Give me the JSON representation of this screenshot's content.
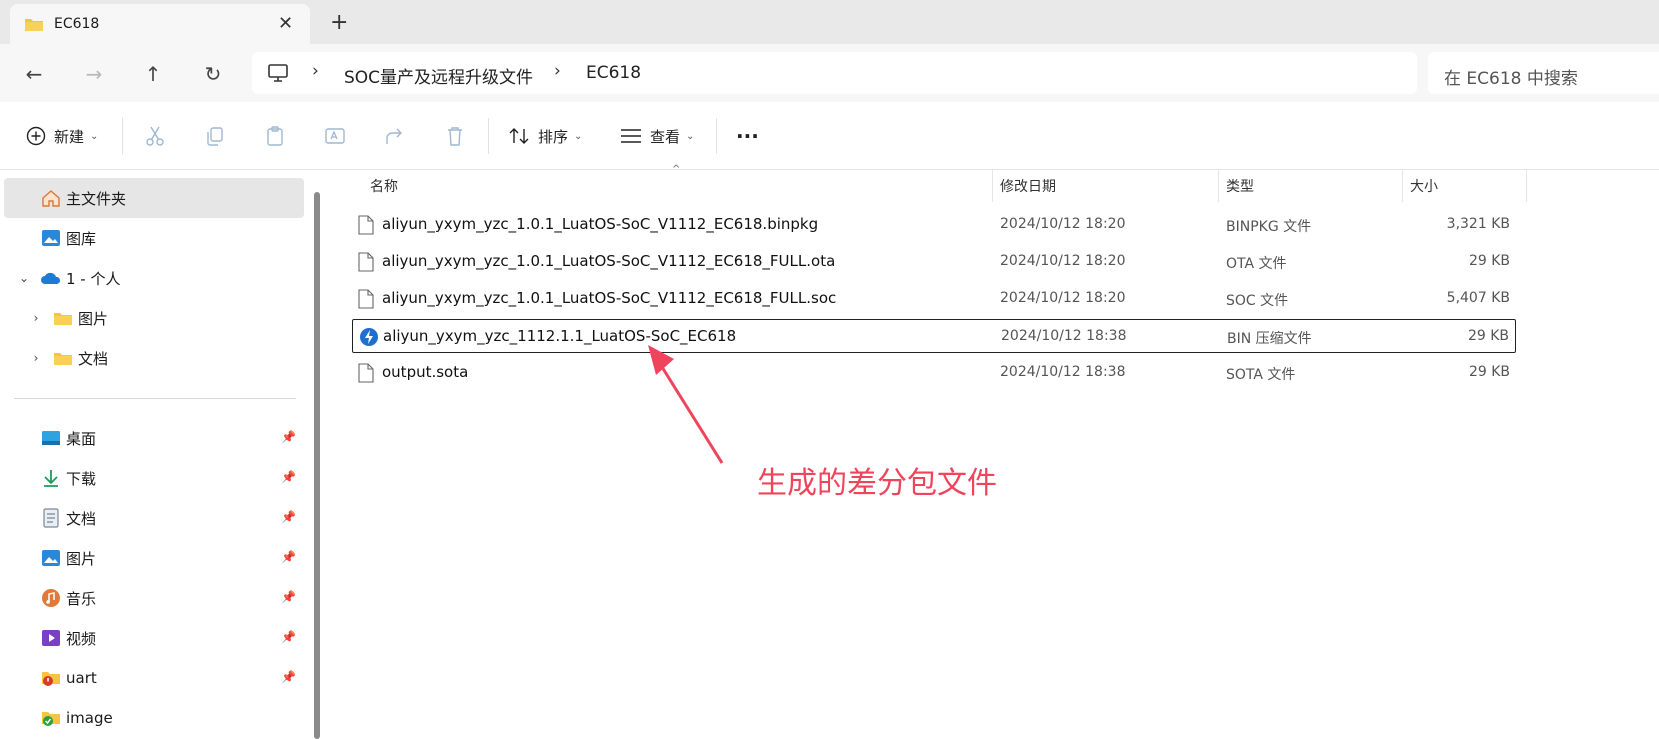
{
  "window": {
    "tab_title": "EC618",
    "close_glyph": "✕",
    "newtab_glyph": "+"
  },
  "nav": {
    "back_glyph": "←",
    "forward_glyph": "→",
    "up_glyph": "↑",
    "refresh_glyph": "↻"
  },
  "breadcrumb": {
    "separator": "›",
    "items": [
      "SOC量产及远程升级文件",
      "EC618"
    ]
  },
  "search": {
    "placeholder": "在 EC618 中搜索"
  },
  "toolbar": {
    "new_label": "新建",
    "sort_label": "排序",
    "view_label": "查看",
    "more_glyph": "···",
    "chevron": "⌄"
  },
  "sidebar": {
    "home": "主文件夹",
    "gallery": "图库",
    "onedrive": "1 - 个人",
    "onedrive_children": [
      "图片",
      "文档"
    ],
    "quick_access": [
      {
        "label": "桌面",
        "icon": "desktop-icon"
      },
      {
        "label": "下载",
        "icon": "download-icon"
      },
      {
        "label": "文档",
        "icon": "documents-icon"
      },
      {
        "label": "图片",
        "icon": "pictures-icon"
      },
      {
        "label": "音乐",
        "icon": "music-icon"
      },
      {
        "label": "视频",
        "icon": "video-icon"
      },
      {
        "label": "uart",
        "icon": "folder-icon"
      },
      {
        "label": "image",
        "icon": "folder-icon"
      }
    ],
    "pin_glyph": "📌",
    "expand_glyph": "›",
    "expanded_glyph": "⌄"
  },
  "columns": {
    "name": "名称",
    "date": "修改日期",
    "type": "类型",
    "size": "大小"
  },
  "files": [
    {
      "name": "aliyun_yxym_yzc_1.0.1_LuatOS-SoC_V1112_EC618.binpkg",
      "date": "2024/10/12 18:20",
      "type": "BINPKG 文件",
      "size": "3,321 KB",
      "icon": "file-icon"
    },
    {
      "name": "aliyun_yxym_yzc_1.0.1_LuatOS-SoC_V1112_EC618_FULL.ota",
      "date": "2024/10/12 18:20",
      "type": "OTA 文件",
      "size": "29 KB",
      "icon": "file-icon"
    },
    {
      "name": "aliyun_yxym_yzc_1.0.1_LuatOS-SoC_V1112_EC618_FULL.soc",
      "date": "2024/10/12 18:20",
      "type": "SOC 文件",
      "size": "5,407 KB",
      "icon": "file-icon"
    },
    {
      "name": "aliyun_yxym_yzc_1112.1.1_LuatOS-SoC_EC618",
      "date": "2024/10/12 18:38",
      "type": "BIN 压缩文件",
      "size": "29 KB",
      "icon": "bin-archive-icon"
    },
    {
      "name": "output.sota",
      "date": "2024/10/12 18:38",
      "type": "SOTA 文件",
      "size": "29 KB",
      "icon": "file-icon"
    }
  ],
  "annotation": {
    "text": "生成的差分包文件",
    "color": "#f0435c"
  },
  "colors": {
    "accent": "#0067c0",
    "folder": "#f5c542"
  }
}
